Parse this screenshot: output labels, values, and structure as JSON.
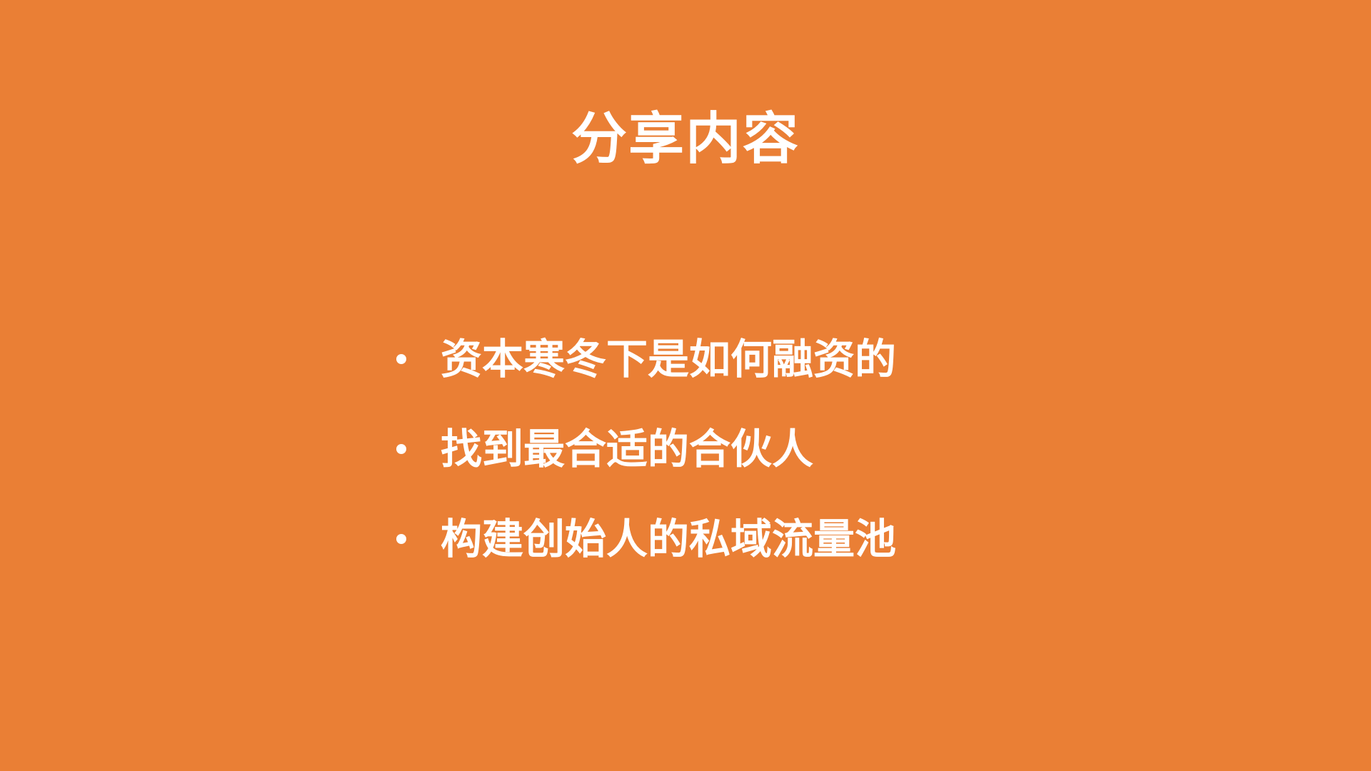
{
  "slide": {
    "background_color": "#EA7F35",
    "text_color": "#FFFFFF",
    "title": "分享内容",
    "bullets": [
      {
        "text": "资本寒冬下是如何融资的"
      },
      {
        "text": "找到最合适的合伙人"
      },
      {
        "text": "构建创始人的私域流量池"
      }
    ]
  }
}
